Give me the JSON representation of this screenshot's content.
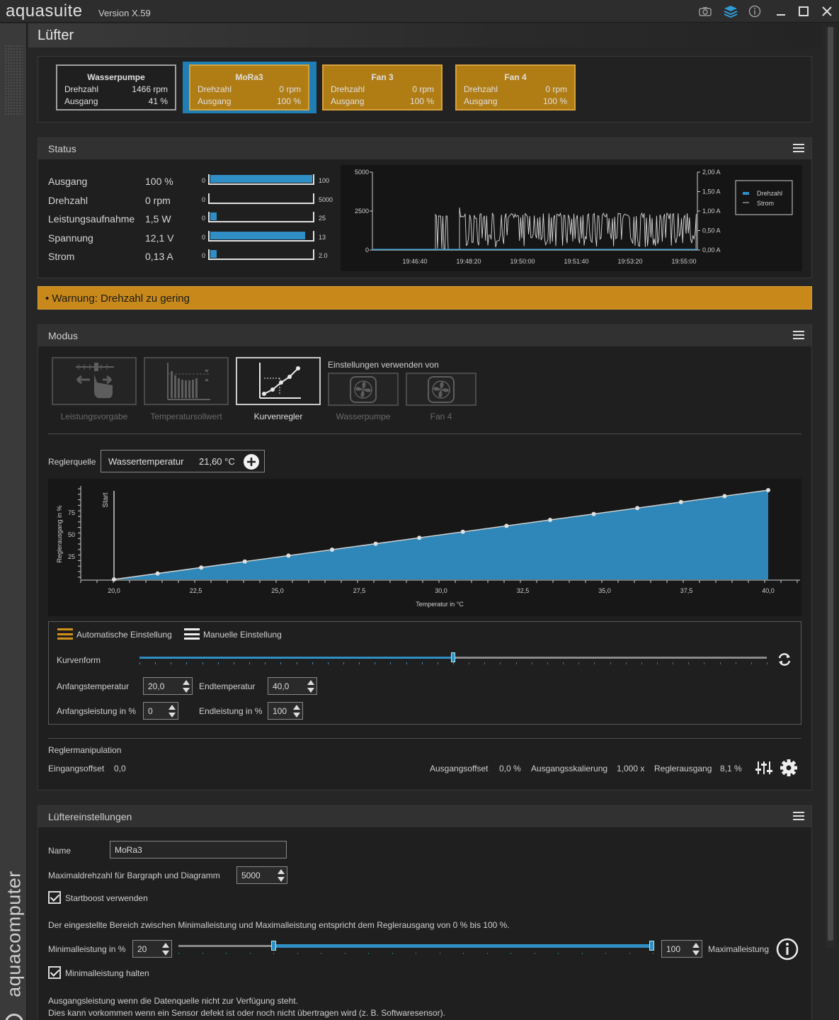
{
  "titlebar": {
    "brand": "aquasuite",
    "version": "Version X.59",
    "icons": [
      "camera-icon",
      "layers-icon",
      "info-icon",
      "minimize-icon",
      "maximize-icon",
      "close-icon"
    ]
  },
  "sidebar": {
    "brand": "aquacomputer"
  },
  "page": {
    "title": "Lüfter"
  },
  "devices": [
    {
      "name": "Wasserpumpe",
      "speed_label": "Drehzahl",
      "speed": "1466 rpm",
      "output_label": "Ausgang",
      "output": "41 %",
      "style": "gray"
    },
    {
      "name": "MoRa3",
      "speed_label": "Drehzahl",
      "speed": "0 rpm",
      "output_label": "Ausgang",
      "output": "100 %",
      "style": "orange",
      "selected": true
    },
    {
      "name": "Fan 3",
      "speed_label": "Drehzahl",
      "speed": "0 rpm",
      "output_label": "Ausgang",
      "output": "100 %",
      "style": "orange"
    },
    {
      "name": "Fan 4",
      "speed_label": "Drehzahl",
      "speed": "0 rpm",
      "output_label": "Ausgang",
      "output": "100 %",
      "style": "orange"
    }
  ],
  "status": {
    "title": "Status",
    "rows": [
      {
        "label": "Ausgang",
        "value": "100 %",
        "min": "0",
        "max": "100",
        "fill": 1.0
      },
      {
        "label": "Drehzahl",
        "value": "0 rpm",
        "min": "0",
        "max": "5000",
        "fill": 0.0
      },
      {
        "label": "Leistungsaufnahme",
        "value": "1,5 W",
        "min": "0",
        "max": "25",
        "fill": 0.06
      },
      {
        "label": "Spannung",
        "value": "12,1 V",
        "min": "0",
        "max": "13",
        "fill": 0.93
      },
      {
        "label": "Strom",
        "value": "0,13 A",
        "min": "0",
        "max": "2.0",
        "fill": 0.065
      }
    ],
    "chart": {
      "left_ticks": [
        "5000",
        "2500",
        "0"
      ],
      "right_ticks": [
        "2,00 A",
        "1,50 A",
        "1,00 A",
        "0,50 A",
        "0,00 A"
      ],
      "x_ticks": [
        "19:46:40",
        "19:48:20",
        "19:50:00",
        "19:51:40",
        "19:53:20",
        "19:55:00"
      ],
      "legend": [
        "Drehzahl",
        "Strom"
      ],
      "series_color": "#2f8fc4"
    }
  },
  "warning": {
    "text": "• Warnung: Drehzahl zu gering",
    "color": "#c8891a"
  },
  "mode": {
    "title": "Modus",
    "buttons": [
      {
        "label": "Leistungsvorgabe",
        "active": false
      },
      {
        "label": "Temperatursollwert",
        "active": false
      },
      {
        "label": "Kurvenregler",
        "active": true
      }
    ],
    "use_settings_label": "Einstellungen verwenden von",
    "use_settings": [
      "Wasserpumpe",
      "Fan 4"
    ],
    "source_label": "Reglerquelle",
    "source_name": "Wassertemperatur",
    "source_value": "21,60 °C",
    "curve": {
      "ylabel": "Reglerausgang in %",
      "xlabel": "Temperatur in °C",
      "start_label": "Start",
      "y_ticks": [
        "75",
        "50",
        "25"
      ],
      "x_ticks": [
        "20,0",
        "22,5",
        "25,0",
        "27,5",
        "30,0",
        "32,5",
        "35,0",
        "37,5",
        "40,0"
      ]
    },
    "auto_label": "Automatische Einstellung",
    "manual_label": "Manuelle Einstellung",
    "curve_shape_label": "Kurvenform",
    "curve_shape_value": 0.5,
    "start_temp_label": "Anfangstemperatur",
    "start_temp": "20,0",
    "end_temp_label": "Endtemperatur",
    "end_temp": "40,0",
    "start_power_label": "Anfangsleistung in %",
    "start_power": "0",
    "end_power_label": "Endleistung in %",
    "end_power": "100",
    "manip_title": "Reglermanipulation",
    "in_offset_label": "Eingangsoffset",
    "in_offset": "0,0",
    "out_offset_label": "Ausgangsoffset",
    "out_offset": "0,0 %",
    "out_scale_label": "Ausgangsskalierung",
    "out_scale": "1,000 x",
    "ctrl_out_label": "Reglerausgang",
    "ctrl_out": "8,1 %"
  },
  "fan_settings": {
    "title": "Lüftereinstellungen",
    "name_label": "Name",
    "name": "MoRa3",
    "maxrpm_label": "Maximaldrehzahl für Bargraph und Diagramm",
    "maxrpm": "5000",
    "startboost_label": "Startboost verwenden",
    "range_note": "Der eingestellte Bereich zwischen Minimalleistung und Maximalleistung entspricht dem Reglerausgang von 0 % bis 100 %.",
    "min_label": "Minimalleistung in %",
    "min": "20",
    "max": "100",
    "max_label": "Maximalleistung",
    "hold_min_label": "Minimalleistung halten",
    "fallback_note_1": "Ausgangsleistung wenn die Datenquelle nicht zur Verfügung steht.",
    "fallback_note_2": "Dies kann vorkommen wenn ein Sensor defekt ist oder noch nicht übertragen wird (z. B. Softwaresensor)."
  }
}
